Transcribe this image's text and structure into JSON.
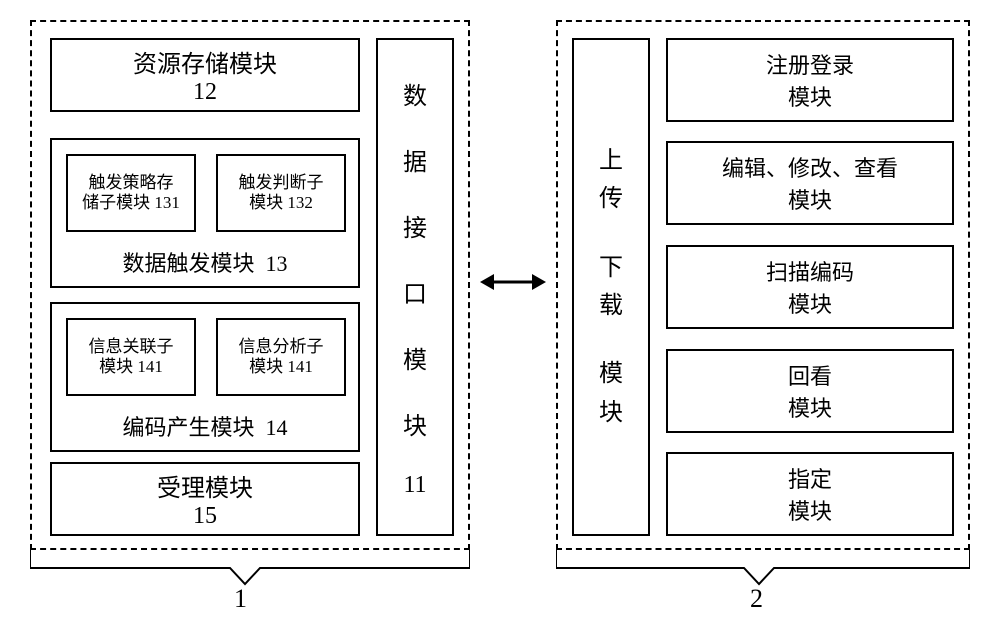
{
  "left": {
    "id_label": "1",
    "resource_storage": {
      "title": "资源存储模块",
      "num": "12"
    },
    "data_trigger": {
      "title": "数据触发模块",
      "num": "13",
      "sub1": {
        "title": "触发策略存储子模块",
        "num": "131"
      },
      "sub2": {
        "title": "触发判断子模块",
        "num": "132"
      }
    },
    "encoding_gen": {
      "title": "编码产生模块",
      "num": "14",
      "sub1": {
        "title": "信息关联子模块",
        "num": "141"
      },
      "sub2": {
        "title": "信息分析子模块",
        "num": "141"
      }
    },
    "acceptance": {
      "title": "受理模块",
      "num": "15"
    },
    "data_interface": {
      "c1": "数",
      "c2": "据",
      "c3": "接",
      "c4": "口",
      "c5": "模",
      "c6": "块",
      "num": "11"
    }
  },
  "right": {
    "id_label": "2",
    "upload_download": {
      "c1": "上",
      "c2": "传",
      "c3": "下",
      "c4": "载",
      "c5": "模",
      "c6": "块"
    },
    "register_login": {
      "l1": "注册登录",
      "l2": "模块"
    },
    "edit_view": {
      "l1": "编辑、修改、查看",
      "l2": "模块"
    },
    "scan_encode": {
      "l1": "扫描编码",
      "l2": "模块"
    },
    "playback": {
      "l1": "回看",
      "l2": "模块"
    },
    "assign": {
      "l1": "指定",
      "l2": "模块"
    }
  }
}
